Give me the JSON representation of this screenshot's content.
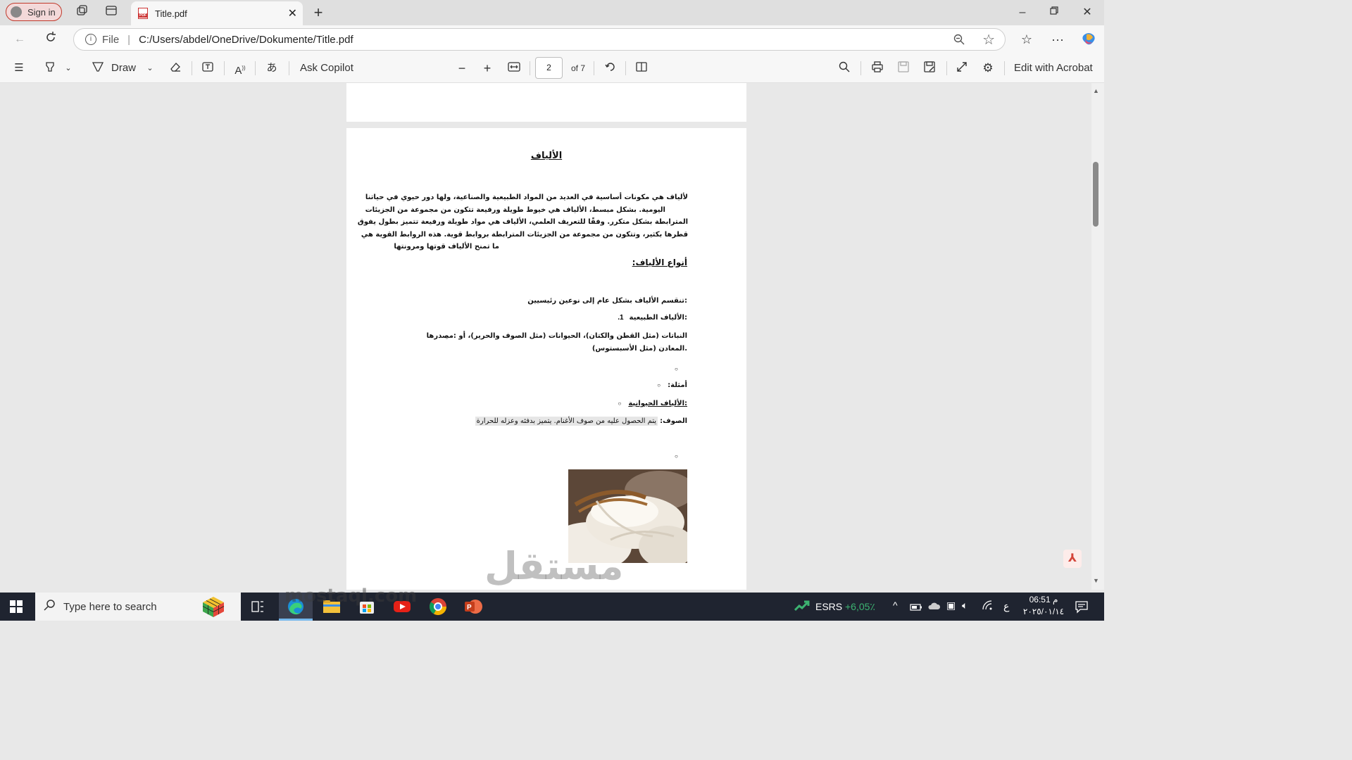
{
  "browser": {
    "signin_label": "Sign in",
    "tab_title": "Title.pdf",
    "address_scheme": "File",
    "address_url": "C:/Users/abdel/OneDrive/Dokumente/Title.pdf"
  },
  "pdf_toolbar": {
    "draw_label": "Draw",
    "ask_copilot_label": "Ask Copilot",
    "current_page": "2",
    "page_total": "of 7",
    "edit_acrobat_label": "Edit with Acrobat"
  },
  "document": {
    "title": "الألياف",
    "intro_lines": [
      "لألياف هي مكونات أساسية في العديد من المواد الطبيعية والصناعية، ولها دور حيوي في حياتنا",
      "اليومية. بشكل مبسط، الألياف هي خيوط طويلة ورفيعة تتكون من مجموعة من الجزيئات",
      "المترابطة بشكل متكرر. وفقًا للتعريف العلمي، الألياف هي مواد طويلة ورفيعة تتميز بطول يفوق",
      "قطرها بكثير، وتتكون من مجموعة من الجزيئات المترابطة بروابط قوية. هذه الروابط القوية هي",
      "ما تمنح الألياف قوتها ومرونتها"
    ],
    "types_heading": "أنواع الألياف:",
    "division_text": ":تنقسم الألياف بشكل عام إلى نوعين رئيسيين",
    "natural_heading": ":الألياف الطبيعية",
    "natural_number": ".1",
    "sources_line1": "النباتات (مثل القطن والكتان)، الحيوانات (مثل الصوف والحرير)، أو :مصدرها",
    "sources_line2": ".المعادن (مثل الأسبستوس)",
    "examples_label": "أمثلة:",
    "animal_heading": ":الألياف الحيوانية",
    "wool_label": "الصوف:",
    "wool_text": "يتم الحصول عليه من صوف الأغنام. يتميز بدفئه وعزله للحرارة"
  },
  "watermark": {
    "arabic": "مستقل",
    "latin": "mostaql.com"
  },
  "taskbar": {
    "search_placeholder": "Type here to search",
    "stock_label": "ESRS",
    "stock_change": "+6,05٪",
    "time": "06:51 م",
    "date": "٢٠٢٥/٠١/١٤",
    "lang": "ع"
  },
  "colors": {
    "accent_red": "#c0392b",
    "stock_green": "#3cb371",
    "taskbar_bg": "#1f2430"
  }
}
